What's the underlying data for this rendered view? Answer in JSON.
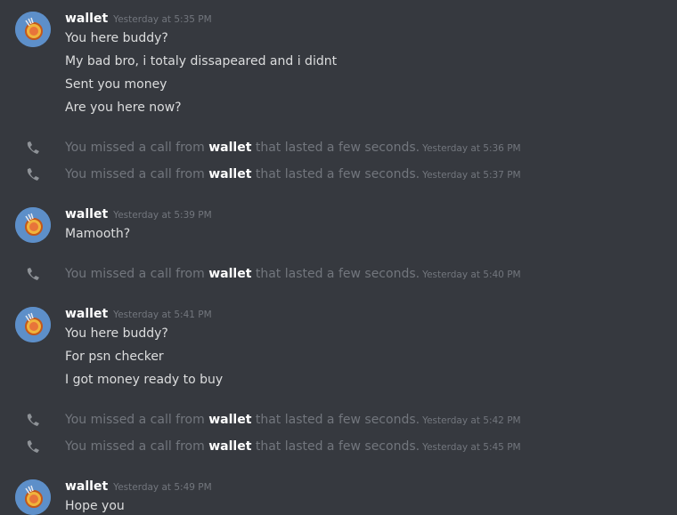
{
  "groups": [
    {
      "username": "wallet",
      "timestamp": "Yesterday at 5:35 PM",
      "lines": [
        "You here buddy?",
        "My bad bro, i totaly dissapeared and i didnt",
        "Sent you money",
        "Are you here now?"
      ]
    },
    {
      "username": "wallet",
      "timestamp": "Yesterday at 5:39 PM",
      "lines": [
        "Mamooth?"
      ]
    },
    {
      "username": "wallet",
      "timestamp": "Yesterday at 5:41 PM",
      "lines": [
        "You here buddy?",
        "For psn checker",
        "I got money ready to buy"
      ]
    },
    {
      "username": "wallet",
      "timestamp": "Yesterday at 5:49 PM",
      "lines": [
        "Hope you"
      ]
    }
  ],
  "calls": [
    {
      "prefix": "You missed a call from ",
      "caller": "wallet",
      "suffix": " that lasted a few seconds.",
      "timestamp": "Yesterday at 5:36 PM"
    },
    {
      "prefix": "You missed a call from ",
      "caller": "wallet",
      "suffix": " that lasted a few seconds.",
      "timestamp": "Yesterday at 5:37 PM"
    },
    {
      "prefix": "You missed a call from ",
      "caller": "wallet",
      "suffix": " that lasted a few seconds.",
      "timestamp": "Yesterday at 5:40 PM"
    },
    {
      "prefix": "You missed a call from ",
      "caller": "wallet",
      "suffix": " that lasted a few seconds.",
      "timestamp": "Yesterday at 5:42 PM"
    },
    {
      "prefix": "You missed a call from ",
      "caller": "wallet",
      "suffix": " that lasted a few seconds.",
      "timestamp": "Yesterday at 5:45 PM"
    }
  ],
  "icons": {
    "avatar": "coin-avatar-icon",
    "call": "phone-missed-icon"
  },
  "colors": {
    "background": "#36393f",
    "username": "#ffffff",
    "message_text": "#dcddde",
    "muted": "#72767d",
    "avatar_bg": "#5d8fc9"
  }
}
